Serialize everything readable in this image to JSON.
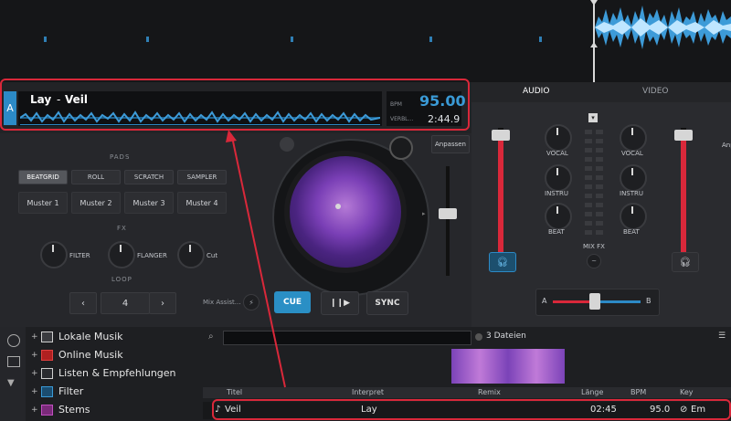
{
  "deck": {
    "letter": "A",
    "artist": "Lay",
    "separator": "-",
    "title": "Veil",
    "bpm_label": "BPM",
    "bpm_value": "95.00",
    "remaining_label": "VERBL...",
    "remaining_value": "2:44.9"
  },
  "pads": {
    "section_label": "PADS",
    "modes": [
      "BEATGRID",
      "ROLL",
      "SCRATCH",
      "SAMPLER"
    ],
    "buttons": [
      "Muster 1",
      "Muster 2",
      "Muster 3",
      "Muster 4"
    ]
  },
  "fx": {
    "section_label": "FX",
    "knobs": [
      "FILTER",
      "FLANGER",
      "Cut"
    ]
  },
  "loop": {
    "section_label": "LOOP",
    "prev": "‹",
    "value": "4",
    "next": "›",
    "mix_assist": "Mix Assist..."
  },
  "transport": {
    "cue": "CUE",
    "play_pause": "❙❙▶",
    "sync": "SYNC",
    "pitch_adjust": "Anpassen"
  },
  "mixer": {
    "tabs": [
      "AUDIO",
      "VIDEO"
    ],
    "eq_left": [
      "VOCAL",
      "INSTRU",
      "BEAT"
    ],
    "eq_right": [
      "VOCAL",
      "INSTRU",
      "BEAT"
    ],
    "mix_fx": "MIX FX",
    "crossfader_left": "A",
    "crossfader_right": "B",
    "right_partial": "Anp"
  },
  "browser": {
    "tree": [
      "Lokale Musik",
      "Online Musik",
      "Listen & Empfehlungen",
      "Filter",
      "Stems"
    ],
    "file_count": "3 Dateien",
    "columns": [
      "Titel",
      "Interpret",
      "Remix",
      "Länge",
      "BPM",
      "Key"
    ],
    "rows": [
      {
        "titel": "Veil",
        "interpret": "Lay",
        "remix": "",
        "laenge": "02:45",
        "bpm": "95.0",
        "key": "Em"
      }
    ]
  },
  "colors": {
    "accent": "#2c8ac6",
    "highlight": "#d9283a"
  }
}
